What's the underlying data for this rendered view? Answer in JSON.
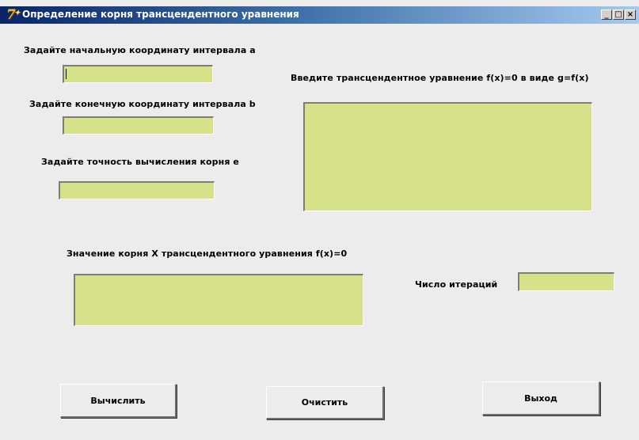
{
  "window": {
    "title": "Определение корня трансцендентного уравнения",
    "app_icon_glyph": "7",
    "controls": {
      "minimize": "_",
      "maximize": "□",
      "close": "×"
    }
  },
  "form": {
    "label_a": "Задайте начальную координату интервала  a",
    "label_b": "Задайте конечную координату интервала   b",
    "label_e": "Задайте точность вычисления корня  e",
    "label_equation": "Введите трансцендентное уравнение f(x)=0 в виде  g=f(x)",
    "label_root": "Значение корня  X  трансцендентного уравнения  f(x)=0",
    "label_iterations": "Число итераций",
    "value_a": "",
    "value_b": "",
    "value_e": "",
    "value_equation": "",
    "value_root": "",
    "value_iterations": ""
  },
  "buttons": {
    "calculate": "Вычислить",
    "clear": "Очистить",
    "exit": "Выход"
  },
  "colors": {
    "field_background": "#d5e28a",
    "form_background": "#ececec",
    "titlebar_start": "#0a246a"
  }
}
